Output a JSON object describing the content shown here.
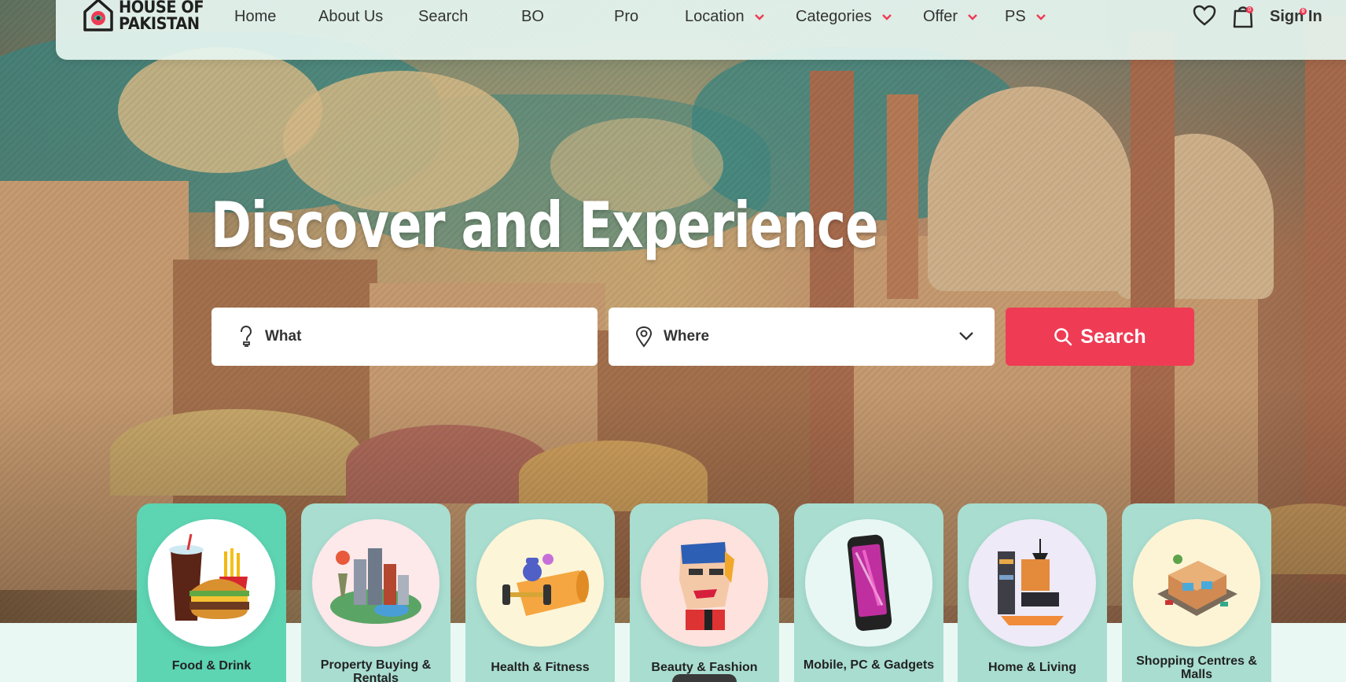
{
  "brand": {
    "line1": "HOUSE OF",
    "line2": "PAKISTAN"
  },
  "nav": {
    "items": [
      {
        "label": "Home"
      },
      {
        "label": "About Us"
      },
      {
        "label": "Search"
      },
      {
        "label": "BO"
      },
      {
        "label": "Pro"
      },
      {
        "label": "Location"
      },
      {
        "label": "Categories"
      },
      {
        "label": "Offer"
      },
      {
        "label": "PS"
      }
    ],
    "cart_count": "0",
    "wishlist_count": "0",
    "signin_label": "Sign In"
  },
  "hero": {
    "headline": "Discover and Experience"
  },
  "search": {
    "what_placeholder": "What",
    "where_placeholder": "Where",
    "button_label": "Search"
  },
  "categories": [
    {
      "label": "Food & Drink",
      "icon": "food-drink-icon"
    },
    {
      "label": "Property Buying & Rentals",
      "icon": "property-icon"
    },
    {
      "label": "Health & Fitness",
      "icon": "fitness-icon"
    },
    {
      "label": "Beauty & Fashion",
      "icon": "beauty-icon"
    },
    {
      "label": "Mobile, PC & Gadgets",
      "icon": "mobile-icon"
    },
    {
      "label": "Home & Living",
      "icon": "home-living-icon"
    },
    {
      "label": "Shopping Centres & Malls",
      "icon": "shopping-icon"
    }
  ],
  "colors": {
    "accent": "#ef3b54",
    "card": "#a8ddd0",
    "card_active": "#5dd4b2",
    "nav_bg": "#e6f5f0"
  }
}
